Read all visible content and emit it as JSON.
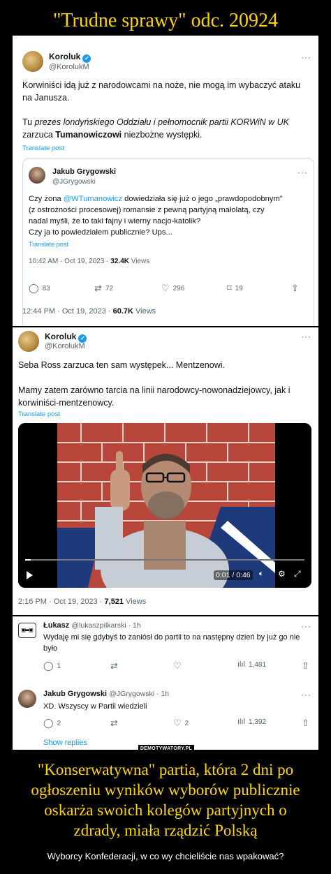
{
  "page_title": "\"Trudne sprawy\" odc. 20924",
  "tweet1": {
    "name": "Koroluk",
    "handle": "@KorolukM",
    "more": "···",
    "text_l1": "Korwiniści idą już z narodowcami na noże, nie mogą im wybaczyć ataku",
    "text_l2": "na Janusza.",
    "text_l3_a": "Tu ",
    "text_l3_i": "prezes londyńskiego Oddziału i pełnomocnik partii KORWiN w UK",
    "text_l4_a": "zarzuca ",
    "text_l4_b": "Tumanowiczowi",
    "text_l4_c": " niezbożne występki.",
    "translate": "Translate post",
    "timestamp": "12:44 PM · Oct 19, 2023 · ",
    "views": "60.7K",
    "views_label": " Views"
  },
  "quote": {
    "name": "Jakub Grygowski",
    "handle": "@JGrygowski",
    "more": "···",
    "l1_a": "Czy żona ",
    "l1_mention": "@WTumanowicz",
    "l1_b": " dowiedziała się już o jego „prawdopodobnym\"",
    "l2": "(z ostrożności procesowej) romansie z pewną partyjną małolatą, czy",
    "l3": "nadal myśli, że to taki fajny i wierny nacjo-katolik?",
    "l4": "Czy ja to powiedziałem publicznie? Ups...",
    "translate": "Translate post",
    "timestamp": "10:42 AM · Oct 19, 2023 · ",
    "views": "32.4K",
    "views_label": " Views",
    "replies": "83",
    "reposts": "72",
    "likes": "296",
    "bookmarks": "19"
  },
  "tweet2": {
    "name": "Koroluk",
    "handle": "@KorolukM",
    "more": "···",
    "l1": "Seba Ross zarzuca ten sam występek... Mentzenowi.",
    "l2": "Mamy zatem zarówno tarcia na linii narodowcy-nowonadziejowcy, jak i",
    "l3": "korwiniści-mentzenowcy.",
    "translate": "Translate post",
    "video_time": "0:01 / 0:46",
    "timestamp": "2:16 PM · Oct 19, 2023 · ",
    "views": "7,521",
    "views_label": " Views",
    "video_progress": 0.02
  },
  "reply1": {
    "name": "Łukasz",
    "handle": "@lukaszpilkarski · 1h",
    "more": "···",
    "l1": "Wydaję mi się gdybyś to zaniósł do partii to na następny dzień by już go nie",
    "l2": "było",
    "replies": "1",
    "views": "1,481"
  },
  "reply2": {
    "name": "Jakub Grygowski",
    "handle": "@JGrygowski · 1h",
    "more": "···",
    "l1": "XD. Wszyscy w Partii wiedzieli",
    "replies": "2",
    "likes": "2",
    "views": "1,392",
    "show_replies": "Show replies"
  },
  "watermark": "DEMOTYWATORY.PL",
  "bottom_title_l1": "\"Konserwatywna\" partia, która 2 dni po",
  "bottom_title_l2": "ogłoszeniu wyników wyborów publicznie",
  "bottom_title_l3": "oskarża swoich kolegów partyjnych o",
  "bottom_title_l4": "zdrady, miała rządzić Polską",
  "subtitle": "Wyborcy Konfederacji, w co wy chcieliście nas wpakować?",
  "colors": {
    "title_yellow": "#ffd700",
    "link_blue": "#1d9bf0",
    "muted_gray": "#536471"
  }
}
